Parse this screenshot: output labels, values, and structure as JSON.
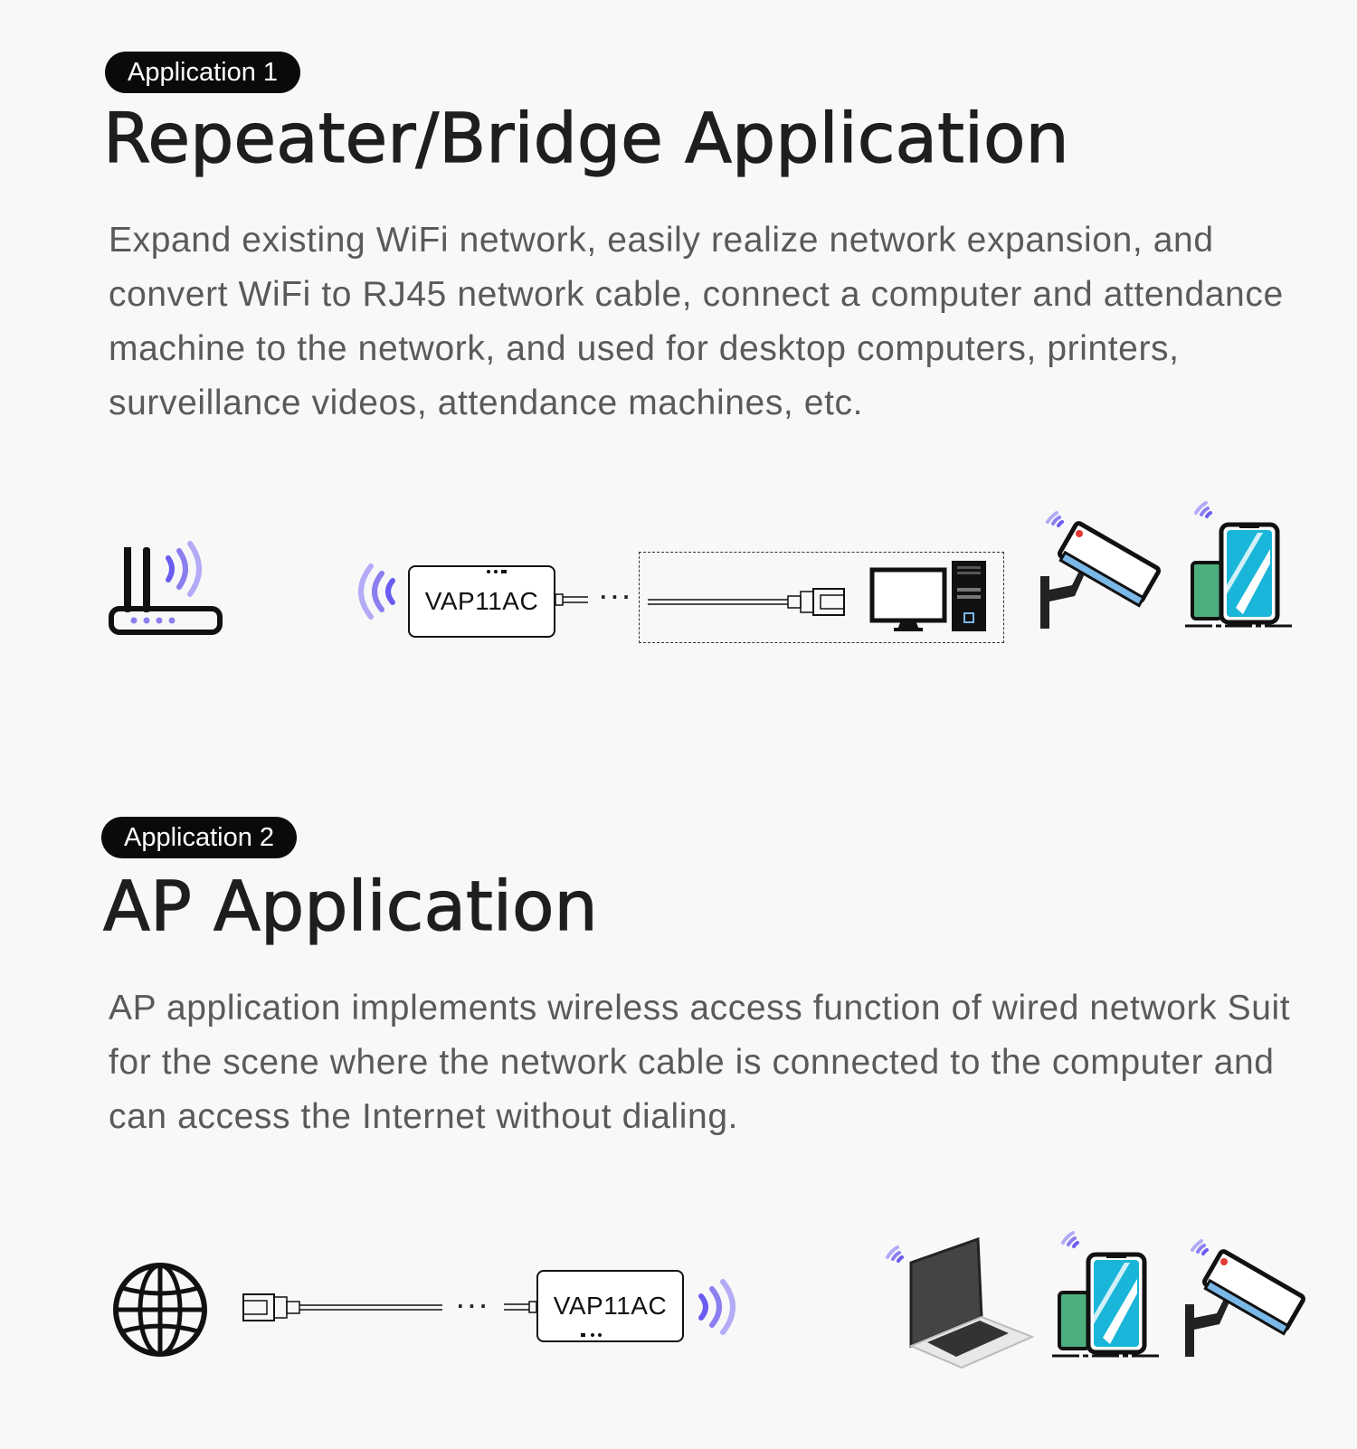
{
  "sections": [
    {
      "badge": "Application 1",
      "title": "Repeater/Bridge Application",
      "description": "Expand existing WiFi network, easily realize network expansion, and convert WiFi to RJ45 network cable, connect a computer and attendance machine to the network, and used for desktop computers, printers, surveillance videos, attendance machines, etc.",
      "diagram": {
        "device_label": "VAP11AC",
        "connector_dots": "···",
        "icons": [
          "router-icon",
          "wifi-signal-icon",
          "ethernet-cable-icon",
          "desktop-computer-icon",
          "security-camera-icon",
          "smartphone-icon"
        ]
      }
    },
    {
      "badge": "Application 2",
      "title": "AP Application",
      "description": "AP application implements wireless access function of wired network Suit for the scene where the network cable is connected to the computer and can access the Internet without dialing.",
      "diagram": {
        "device_label": "VAP11AC",
        "connector_dots": "···",
        "icons": [
          "globe-icon",
          "ethernet-cable-icon",
          "wifi-signal-icon",
          "laptop-icon",
          "smartphone-icon",
          "security-camera-icon"
        ]
      }
    }
  ],
  "colors": {
    "accent_wifi": "#8b7ff0",
    "phone_cyan": "#1ab6d9",
    "phone_green": "#4caf7d",
    "camera_blue": "#7ab8e8",
    "indicator_red": "#e53935",
    "badge_bg": "#0a0a0a"
  }
}
